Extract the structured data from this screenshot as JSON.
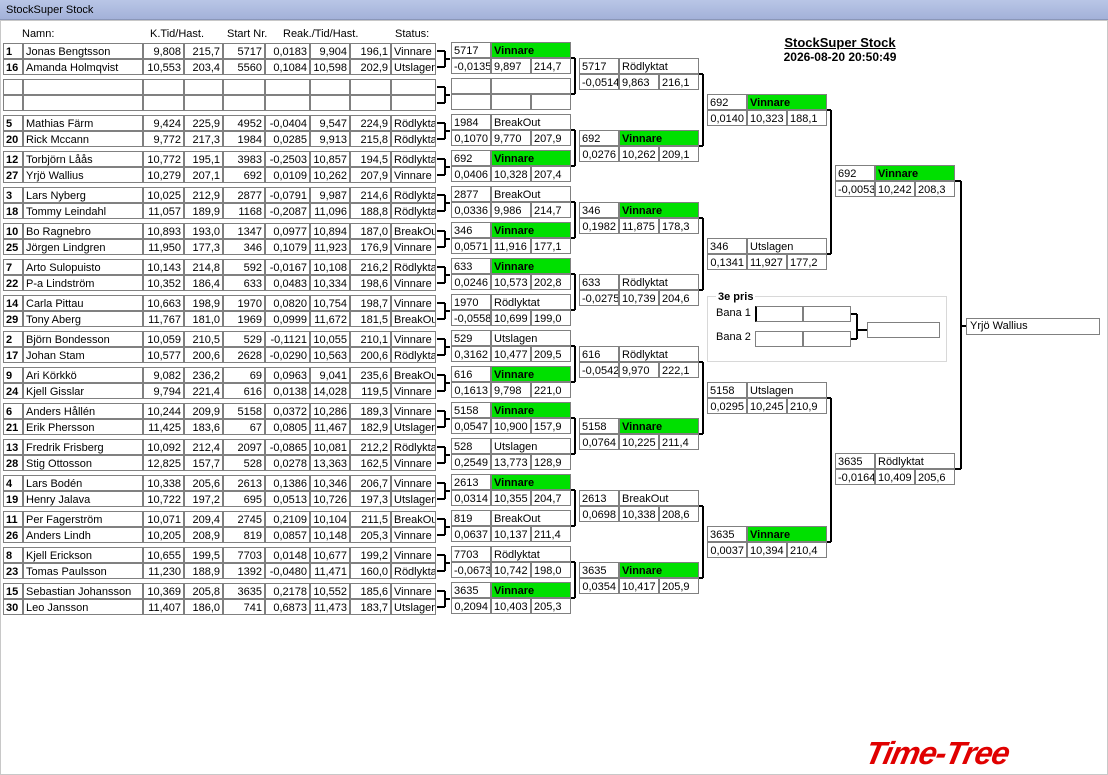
{
  "window": {
    "title": "StockSuper Stock"
  },
  "event": {
    "title": "StockSuper Stock",
    "datetime": "2026-08-20 20:50:49"
  },
  "columns": {
    "name": "Namn:",
    "time_speed": "K.Tid/Hast.",
    "start": "Start Nr.",
    "reaction": "Reak./Tid/Hast.",
    "status": "Status:"
  },
  "pairs": [
    [
      {
        "seed": "1",
        "name": "Jonas Bengtsson",
        "kt": "9,808",
        "kh": "215,7",
        "start": "5717",
        "reak": "0,0183",
        "t": "9,904",
        "h": "196,1",
        "status": "Vinnare"
      },
      {
        "seed": "16",
        "name": "Amanda Holmqvist",
        "kt": "10,553",
        "kh": "203,4",
        "start": "5560",
        "reak": "0,1084",
        "t": "10,598",
        "h": "202,9",
        "status": "Utslagen"
      }
    ],
    [
      {
        "seed": "",
        "name": "",
        "kt": "",
        "kh": "",
        "start": "",
        "reak": "",
        "t": "",
        "h": "",
        "status": ""
      },
      {
        "seed": "",
        "name": "",
        "kt": "",
        "kh": "",
        "start": "",
        "reak": "",
        "t": "",
        "h": "",
        "status": ""
      }
    ],
    [
      {
        "seed": "5",
        "name": "Mathias Färm",
        "kt": "9,424",
        "kh": "225,9",
        "start": "4952",
        "reak": "-0,0404",
        "t": "9,547",
        "h": "224,9",
        "status": "Rödlyktat"
      },
      {
        "seed": "20",
        "name": "Rick Mccann",
        "kt": "9,772",
        "kh": "217,3",
        "start": "1984",
        "reak": "0,0285",
        "t": "9,913",
        "h": "215,8",
        "status": "Rödlyktat"
      }
    ],
    [
      {
        "seed": "12",
        "name": "Torbjörn Låås",
        "kt": "10,772",
        "kh": "195,1",
        "start": "3983",
        "reak": "-0,2503",
        "t": "10,857",
        "h": "194,5",
        "status": "Rödlyktat"
      },
      {
        "seed": "27",
        "name": "Yrjö Wallius",
        "kt": "10,279",
        "kh": "207,1",
        "start": "692",
        "reak": "0,0109",
        "t": "10,262",
        "h": "207,9",
        "status": "Vinnare"
      }
    ],
    [
      {
        "seed": "3",
        "name": "Lars Nyberg",
        "kt": "10,025",
        "kh": "212,9",
        "start": "2877",
        "reak": "-0,0791",
        "t": "9,987",
        "h": "214,6",
        "status": "Rödlyktat"
      },
      {
        "seed": "18",
        "name": "Tommy  Leindahl",
        "kt": "11,057",
        "kh": "189,9",
        "start": "1168",
        "reak": "-0,2087",
        "t": "11,096",
        "h": "188,8",
        "status": "Rödlyktat"
      }
    ],
    [
      {
        "seed": "10",
        "name": "Bo Ragnebro",
        "kt": "10,893",
        "kh": "193,0",
        "start": "1347",
        "reak": "0,0977",
        "t": "10,894",
        "h": "187,0",
        "status": "BreakOut"
      },
      {
        "seed": "25",
        "name": "Jörgen Lindgren",
        "kt": "11,950",
        "kh": "177,3",
        "start": "346",
        "reak": "0,1079",
        "t": "11,923",
        "h": "176,9",
        "status": "Vinnare"
      }
    ],
    [
      {
        "seed": "7",
        "name": "Arto Sulopuisto",
        "kt": "10,143",
        "kh": "214,8",
        "start": "592",
        "reak": "-0,0167",
        "t": "10,108",
        "h": "216,2",
        "status": "Rödlyktat"
      },
      {
        "seed": "22",
        "name": "P-a Lindström",
        "kt": "10,352",
        "kh": "186,4",
        "start": "633",
        "reak": "0,0483",
        "t": "10,334",
        "h": "198,6",
        "status": "Vinnare"
      }
    ],
    [
      {
        "seed": "14",
        "name": "Carla Pittau",
        "kt": "10,663",
        "kh": "198,9",
        "start": "1970",
        "reak": "0,0820",
        "t": "10,754",
        "h": "198,7",
        "status": "Vinnare"
      },
      {
        "seed": "29",
        "name": "Tony Aberg",
        "kt": "11,767",
        "kh": "181,0",
        "start": "1969",
        "reak": "0,0999",
        "t": "11,672",
        "h": "181,5",
        "status": "BreakOut"
      }
    ],
    [
      {
        "seed": "2",
        "name": "Björn Bondesson",
        "kt": "10,059",
        "kh": "210,5",
        "start": "529",
        "reak": "-0,1121",
        "t": "10,055",
        "h": "210,1",
        "status": "Vinnare"
      },
      {
        "seed": "17",
        "name": "Johan Stam",
        "kt": "10,577",
        "kh": "200,6",
        "start": "2628",
        "reak": "-0,0290",
        "t": "10,563",
        "h": "200,6",
        "status": "Rödlyktat"
      }
    ],
    [
      {
        "seed": "9",
        "name": "Ari Körkkö",
        "kt": "9,082",
        "kh": "236,2",
        "start": "69",
        "reak": "0,0963",
        "t": "9,041",
        "h": "235,6",
        "status": "BreakOut"
      },
      {
        "seed": "24",
        "name": "Kjell Gisslar",
        "kt": "9,794",
        "kh": "221,4",
        "start": "616",
        "reak": "0,0138",
        "t": "14,028",
        "h": "119,5",
        "status": "Vinnare"
      }
    ],
    [
      {
        "seed": "6",
        "name": "Anders Hållén",
        "kt": "10,244",
        "kh": "209,9",
        "start": "5158",
        "reak": "0,0372",
        "t": "10,286",
        "h": "189,3",
        "status": "Vinnare"
      },
      {
        "seed": "21",
        "name": "Erik Phersson",
        "kt": "11,425",
        "kh": "183,6",
        "start": "67",
        "reak": "0,0805",
        "t": "11,467",
        "h": "182,9",
        "status": "Utslagen"
      }
    ],
    [
      {
        "seed": "13",
        "name": "Fredrik Frisberg",
        "kt": "10,092",
        "kh": "212,4",
        "start": "2097",
        "reak": "-0,0865",
        "t": "10,081",
        "h": "212,2",
        "status": "Rödlyktat"
      },
      {
        "seed": "28",
        "name": "Stig Ottosson",
        "kt": "12,825",
        "kh": "157,7",
        "start": "528",
        "reak": "0,0278",
        "t": "13,363",
        "h": "162,5",
        "status": "Vinnare"
      }
    ],
    [
      {
        "seed": "4",
        "name": "Lars Bodén",
        "kt": "10,338",
        "kh": "205,6",
        "start": "2613",
        "reak": "0,1386",
        "t": "10,346",
        "h": "206,7",
        "status": "Vinnare"
      },
      {
        "seed": "19",
        "name": "Henry Jalava",
        "kt": "10,722",
        "kh": "197,2",
        "start": "695",
        "reak": "0,0513",
        "t": "10,726",
        "h": "197,3",
        "status": "Utslagen"
      }
    ],
    [
      {
        "seed": "11",
        "name": "Per  Fagerström",
        "kt": "10,071",
        "kh": "209,4",
        "start": "2745",
        "reak": "0,2109",
        "t": "10,104",
        "h": "211,5",
        "status": "BreakOut"
      },
      {
        "seed": "26",
        "name": "Anders Lindh",
        "kt": "10,205",
        "kh": "208,9",
        "start": "819",
        "reak": "0,0857",
        "t": "10,148",
        "h": "205,3",
        "status": "Vinnare"
      }
    ],
    [
      {
        "seed": "8",
        "name": "Kjell Erickson",
        "kt": "10,655",
        "kh": "199,5",
        "start": "7703",
        "reak": "0,0148",
        "t": "10,677",
        "h": "199,2",
        "status": "Vinnare"
      },
      {
        "seed": "23",
        "name": "Tomas Paulsson",
        "kt": "11,230",
        "kh": "188,9",
        "start": "1392",
        "reak": "-0,0480",
        "t": "11,471",
        "h": "160,0",
        "status": "Rödlyktat"
      }
    ],
    [
      {
        "seed": "15",
        "name": "Sebastian Johansson",
        "kt": "10,369",
        "kh": "205,8",
        "start": "3635",
        "reak": "0,2178",
        "t": "10,552",
        "h": "185,6",
        "status": "Vinnare"
      },
      {
        "seed": "30",
        "name": "Leo Jansson",
        "kt": "11,407",
        "kh": "186,0",
        "start": "741",
        "reak": "0,6873",
        "t": "11,473",
        "h": "183,7",
        "status": "Utslagen"
      }
    ]
  ],
  "round2": [
    [
      {
        "no": "5717",
        "status": "Vinnare",
        "win": true
      },
      {
        "reak": "-0,0135",
        "t": "9,897",
        "h": "214,7"
      }
    ],
    [
      {
        "no": "",
        "status": "",
        "win": false
      },
      {
        "reak": "",
        "t": "",
        "h": ""
      }
    ],
    [
      {
        "no": "1984",
        "status": "BreakOut",
        "win": false
      },
      {
        "reak": "0,1070",
        "t": "9,770",
        "h": "207,9"
      }
    ],
    [
      {
        "no": "692",
        "status": "Vinnare",
        "win": true
      },
      {
        "reak": "0,0406",
        "t": "10,328",
        "h": "207,4"
      }
    ],
    [
      {
        "no": "2877",
        "status": "BreakOut",
        "win": false
      },
      {
        "reak": "0,0336",
        "t": "9,986",
        "h": "214,7"
      }
    ],
    [
      {
        "no": "346",
        "status": "Vinnare",
        "win": true
      },
      {
        "reak": "0,0571",
        "t": "11,916",
        "h": "177,1"
      }
    ],
    [
      {
        "no": "633",
        "status": "Vinnare",
        "win": true
      },
      {
        "reak": "0,0246",
        "t": "10,573",
        "h": "202,8"
      }
    ],
    [
      {
        "no": "1970",
        "status": "Rödlyktat",
        "win": false
      },
      {
        "reak": "-0,0558",
        "t": "10,699",
        "h": "199,0"
      }
    ],
    [
      {
        "no": "529",
        "status": "Utslagen",
        "win": false
      },
      {
        "reak": "0,3162",
        "t": "10,477",
        "h": "209,5"
      }
    ],
    [
      {
        "no": "616",
        "status": "Vinnare",
        "win": true
      },
      {
        "reak": "0,1613",
        "t": "9,798",
        "h": "221,0"
      }
    ],
    [
      {
        "no": "5158",
        "status": "Vinnare",
        "win": true
      },
      {
        "reak": "0,0547",
        "t": "10,900",
        "h": "157,9"
      }
    ],
    [
      {
        "no": "528",
        "status": "Utslagen",
        "win": false
      },
      {
        "reak": "0,2549",
        "t": "13,773",
        "h": "128,9"
      }
    ],
    [
      {
        "no": "2613",
        "status": "Vinnare",
        "win": true
      },
      {
        "reak": "0,0314",
        "t": "10,355",
        "h": "204,7"
      }
    ],
    [
      {
        "no": "819",
        "status": "BreakOut",
        "win": false
      },
      {
        "reak": "0,0637",
        "t": "10,137",
        "h": "211,4"
      }
    ],
    [
      {
        "no": "7703",
        "status": "Rödlyktat",
        "win": false
      },
      {
        "reak": "-0,0673",
        "t": "10,742",
        "h": "198,0"
      }
    ],
    [
      {
        "no": "3635",
        "status": "Vinnare",
        "win": true
      },
      {
        "reak": "0,2094",
        "t": "10,403",
        "h": "205,3"
      }
    ]
  ],
  "round3": [
    [
      {
        "no": "5717",
        "status": "Rödlyktat",
        "win": false
      },
      {
        "reak": "-0,0514",
        "t": "9,863",
        "h": "216,1"
      }
    ],
    [
      {
        "no": "692",
        "status": "Vinnare",
        "win": true
      },
      {
        "reak": "0,0276",
        "t": "10,262",
        "h": "209,1"
      }
    ],
    [
      {
        "no": "346",
        "status": "Vinnare",
        "win": true
      },
      {
        "reak": "0,1982",
        "t": "11,875",
        "h": "178,3"
      }
    ],
    [
      {
        "no": "633",
        "status": "Rödlyktat",
        "win": false
      },
      {
        "reak": "-0,0275",
        "t": "10,739",
        "h": "204,6"
      }
    ],
    [
      {
        "no": "616",
        "status": "Rödlyktat",
        "win": false
      },
      {
        "reak": "-0,0542",
        "t": "9,970",
        "h": "222,1"
      }
    ],
    [
      {
        "no": "5158",
        "status": "Vinnare",
        "win": true
      },
      {
        "reak": "0,0764",
        "t": "10,225",
        "h": "211,4"
      }
    ],
    [
      {
        "no": "2613",
        "status": "BreakOut",
        "win": false
      },
      {
        "reak": "0,0698",
        "t": "10,338",
        "h": "208,6"
      }
    ],
    [
      {
        "no": "3635",
        "status": "Vinnare",
        "win": true
      },
      {
        "reak": "0,0354",
        "t": "10,417",
        "h": "205,9"
      }
    ]
  ],
  "round4": [
    [
      {
        "no": "692",
        "status": "Vinnare",
        "win": true
      },
      {
        "reak": "0,0140",
        "t": "10,323",
        "h": "188,1"
      }
    ],
    [
      {
        "no": "346",
        "status": "Utslagen",
        "win": false
      },
      {
        "reak": "0,1341",
        "t": "11,927",
        "h": "177,2"
      }
    ],
    [
      {
        "no": "5158",
        "status": "Utslagen",
        "win": false
      },
      {
        "reak": "0,0295",
        "t": "10,245",
        "h": "210,9"
      }
    ],
    [
      {
        "no": "3635",
        "status": "Vinnare",
        "win": true
      },
      {
        "reak": "0,0037",
        "t": "10,394",
        "h": "210,4"
      }
    ]
  ],
  "round5": [
    [
      {
        "no": "692",
        "status": "Vinnare",
        "win": true
      },
      {
        "reak": "-0,0053",
        "t": "10,242",
        "h": "208,3"
      }
    ],
    [
      {
        "no": "3635",
        "status": "Rödlyktat",
        "win": false
      },
      {
        "reak": "-0,0164",
        "t": "10,409",
        "h": "205,6"
      }
    ]
  ],
  "third_place": {
    "title": "3e pris",
    "lane1": "Bana 1",
    "lane2": "Bana 2"
  },
  "champion": "Yrjö Wallius",
  "logo_text": "Time-Tree",
  "colors": {
    "winner": "#00e000",
    "logo": "#e00000",
    "titlebar": "#a3b1d9"
  }
}
